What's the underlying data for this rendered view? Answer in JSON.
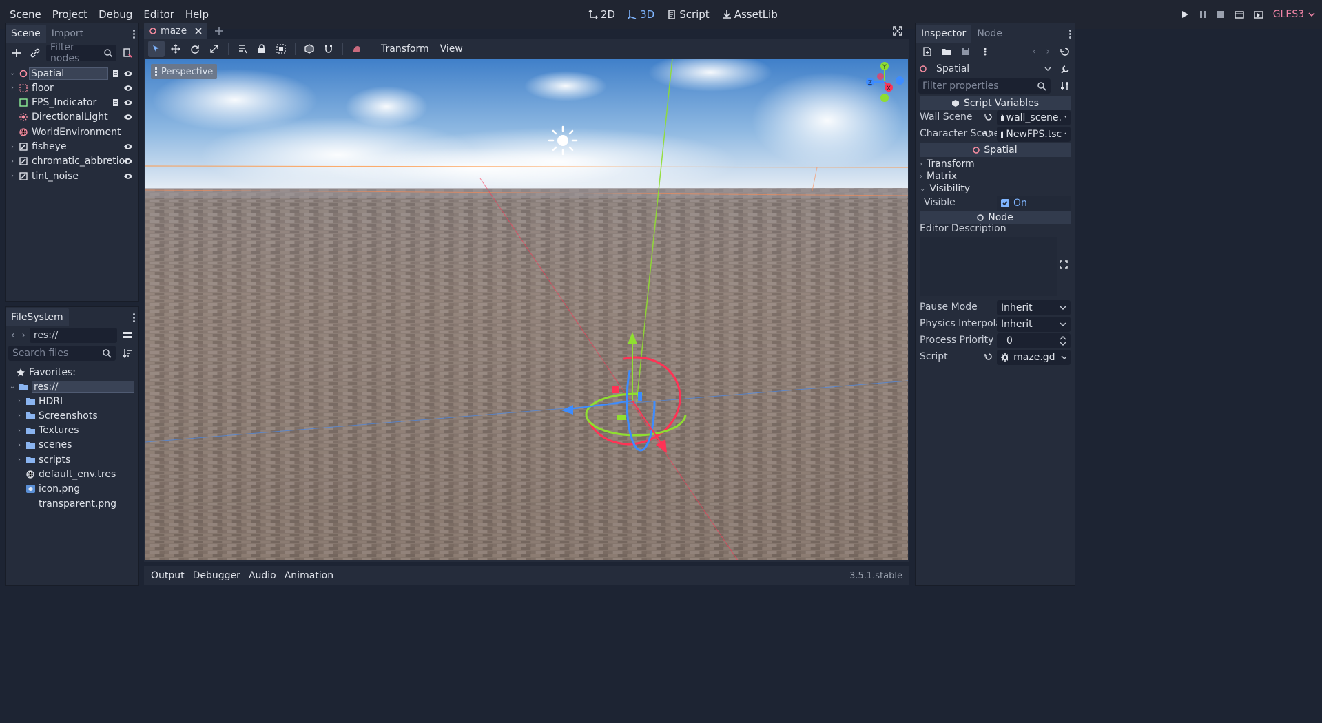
{
  "menu": {
    "items": [
      "Scene",
      "Project",
      "Debug",
      "Editor",
      "Help"
    ]
  },
  "modes": [
    {
      "label": "2D",
      "active": false
    },
    {
      "label": "3D",
      "active": true
    },
    {
      "label": "Script",
      "active": false
    },
    {
      "label": "AssetLib",
      "active": false
    }
  ],
  "renderer": "GLES3",
  "scene_dock": {
    "tabs": [
      "Scene",
      "Import"
    ],
    "filter_placeholder": "Filter nodes",
    "nodes": [
      {
        "name": "Spatial",
        "icon": "spatial-icon",
        "selected": true,
        "script": true,
        "eye": true,
        "arrow": "open"
      },
      {
        "name": "floor",
        "icon": "mesh-icon",
        "script": false,
        "eye": true,
        "arrow": "closed"
      },
      {
        "name": "FPS_Indicator",
        "icon": "control-icon",
        "script": true,
        "eye": true,
        "arrow": "none"
      },
      {
        "name": "DirectionalLight",
        "icon": "light-icon",
        "script": false,
        "eye": true,
        "arrow": "none"
      },
      {
        "name": "WorldEnvironment",
        "icon": "globe-icon",
        "script": false,
        "eye": false,
        "arrow": "none"
      },
      {
        "name": "fisheye",
        "icon": "shader-rect-icon",
        "script": false,
        "eye": true,
        "arrow": "closed"
      },
      {
        "name": "chromatic_abbretion",
        "icon": "shader-rect-icon",
        "script": false,
        "eye": true,
        "arrow": "closed"
      },
      {
        "name": "tint_noise",
        "icon": "shader-rect-icon",
        "script": false,
        "eye": true,
        "arrow": "closed"
      }
    ]
  },
  "filesystem": {
    "title": "FileSystem",
    "path": "res://",
    "search_placeholder": "Search files",
    "favorites_label": "Favorites:",
    "root": "res://",
    "items": [
      {
        "name": "HDRI",
        "type": "folder"
      },
      {
        "name": "Screenshots",
        "type": "folder"
      },
      {
        "name": "Textures",
        "type": "folder"
      },
      {
        "name": "scenes",
        "type": "folder"
      },
      {
        "name": "scripts",
        "type": "folder"
      },
      {
        "name": "default_env.tres",
        "type": "env"
      },
      {
        "name": "icon.png",
        "type": "image"
      },
      {
        "name": "transparent.png",
        "type": "none"
      }
    ]
  },
  "editor": {
    "scene_tab": "maze",
    "toolbar_menus": [
      "Transform",
      "View"
    ],
    "perspective_label": "Perspective",
    "gizmo_axes": [
      "Y",
      "X",
      "Z"
    ],
    "bottom_tabs": [
      "Output",
      "Debugger",
      "Audio",
      "Animation"
    ],
    "version": "3.5.1.stable"
  },
  "inspector": {
    "tabs": [
      "Inspector",
      "Node"
    ],
    "object": "Spatial",
    "filter_placeholder": "Filter properties",
    "script_variables_label": "Script Variables",
    "wall_scene_label": "Wall Scene",
    "wall_scene_value": "wall_scene.",
    "character_scene_label": "Character Scene",
    "character_scene_value": "NewFPS.tsc",
    "spatial_section": "Spatial",
    "transform_label": "Transform",
    "matrix_label": "Matrix",
    "visibility_label": "Visibility",
    "visible_label": "Visible",
    "visible_value": "On",
    "node_section": "Node",
    "editor_description_label": "Editor Description",
    "pause_mode_label": "Pause Mode",
    "pause_mode_value": "Inherit",
    "physics_label": "Physics Interpolati",
    "physics_value": "Inherit",
    "process_priority_label": "Process Priority",
    "process_priority_value": "0",
    "script_label": "Script",
    "script_value": "maze.gd"
  },
  "colors": {
    "accent": "#7fb5ff",
    "renderer": "#f084a6",
    "x_axis": "#ff3355",
    "y_axis": "#8fde30",
    "z_axis": "#3d8cff"
  }
}
